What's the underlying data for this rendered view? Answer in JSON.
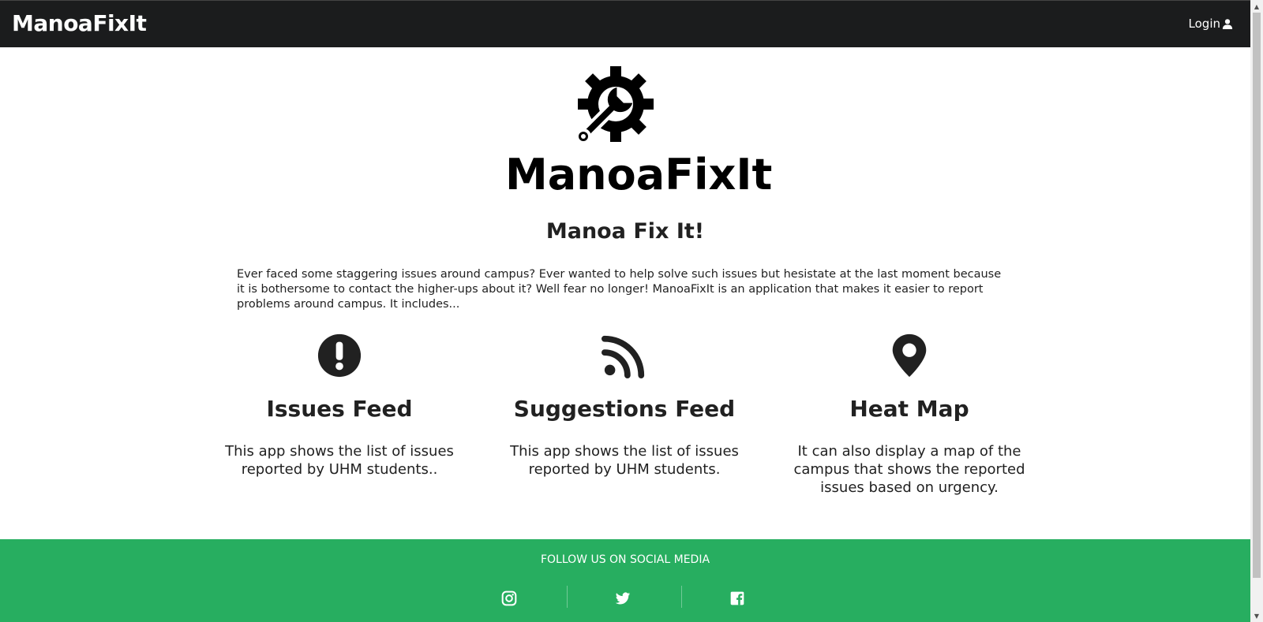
{
  "navbar": {
    "brand": "ManoaFixIt",
    "login_label": "Login"
  },
  "hero": {
    "logo_text": "ManoaFixIt",
    "title": "Manoa Fix It!",
    "intro": "Ever faced some staggering issues around campus? Ever wanted to help solve such issues but hesistate at the last moment because it is bothersome to contact the higher-ups about it? Well fear no longer! ManoaFixIt is an application that makes it easier to report problems around campus. It includes..."
  },
  "features": [
    {
      "icon": "exclamation-circle-icon",
      "title": "Issues Feed",
      "description": "This app shows the list of issues reported by UHM students.."
    },
    {
      "icon": "rss-feed-icon",
      "title": "Suggestions Feed",
      "description": "This app shows the list of issues reported by UHM students."
    },
    {
      "icon": "map-marker-icon",
      "title": "Heat Map",
      "description": "It can also display a map of the campus that shows the reported issues based on urgency."
    }
  ],
  "footer": {
    "title": "FOLLOW US ON SOCIAL MEDIA",
    "social": [
      "instagram-icon",
      "twitter-icon",
      "facebook-icon"
    ]
  },
  "colors": {
    "navbar_bg": "#1b1c1d",
    "footer_bg": "#27ae60",
    "text": "#212121"
  }
}
